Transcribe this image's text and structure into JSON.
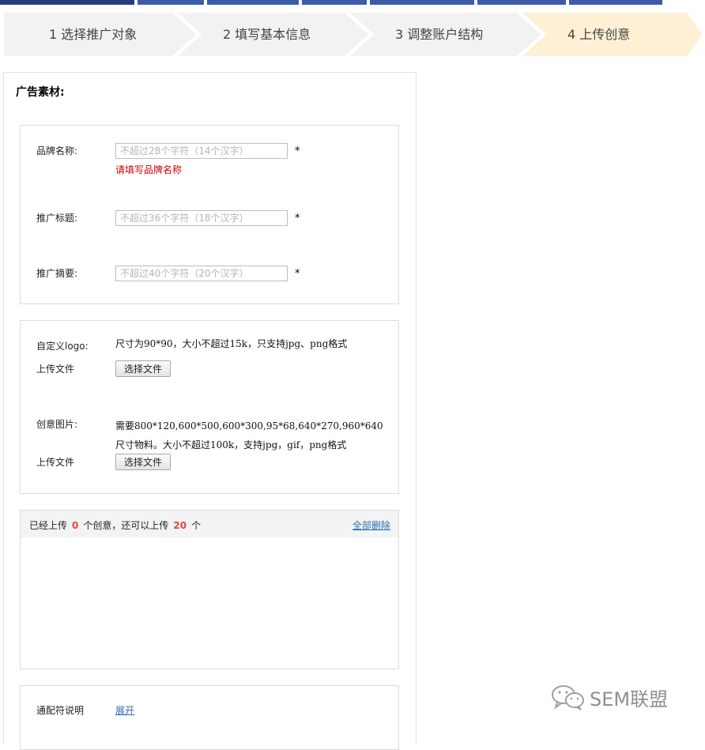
{
  "steps": [
    {
      "label": "1 选择推广对象",
      "active": false
    },
    {
      "label": "2 填写基本信息",
      "active": false
    },
    {
      "label": "3 调整账户结构",
      "active": false
    },
    {
      "label": "4 上传创意",
      "active": true
    }
  ],
  "colors": {
    "step_inactive": "#f2f2f2",
    "step_active": "#fdf0d5",
    "top_bar": "#3d5aa8",
    "error": "#cc0000",
    "count": "#e0473f",
    "link": "#2a6fb5"
  },
  "panel": {
    "title": "广告素材:"
  },
  "brand": {
    "label": "品牌名称:",
    "placeholder": "不超过28个字符（14个汉字）",
    "required": "*",
    "error": "请填写品牌名称"
  },
  "promo_title": {
    "label": "推广标题:",
    "placeholder": "不超过36个字符（18个汉字）",
    "required": "*"
  },
  "summary": {
    "label": "推广摘要:",
    "placeholder": "不超过40个字符（20个汉字）",
    "required": "*"
  },
  "logo": {
    "label": "自定义logo:",
    "desc": "尺寸为90*90，大小不超过15k，只支持jpg、png格式",
    "upload_label": "上传文件",
    "button": "选择文件"
  },
  "creative_image": {
    "label": "创意图片:",
    "desc_line1": "需要800*120,600*500,600*300,95*68,640*270,960*640",
    "desc_line2": "尺寸物料。大小不超过100k，支持jpg，gif，png格式",
    "upload_label": "上传文件",
    "button": "选择文件"
  },
  "upload_status": {
    "prefix": "已经上传",
    "uploaded": "0",
    "middle": "个创意，还可以上传",
    "remaining": "20",
    "suffix": "个",
    "delete_all": "全部删除"
  },
  "wildcard": {
    "label": "通配符说明",
    "expand": "展开"
  },
  "watermark": {
    "text": "SEM联盟",
    "icon": "wechat-icon"
  }
}
